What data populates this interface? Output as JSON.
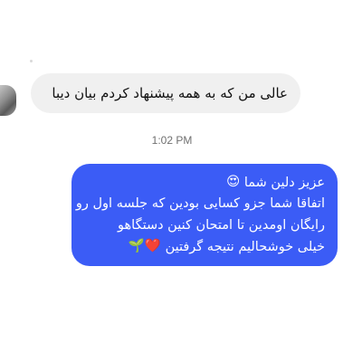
{
  "conversation": {
    "incoming_message": {
      "text": "عالی من که به همه پیشنهاد کردم بیان دیبا"
    },
    "timestamp": "1:02 PM",
    "outgoing_message": {
      "line_1_text": "عزیز دلین شما",
      "line_1_emoji": "😍",
      "line_2": "اتفاقا شما جزو کسایی بودین که جلسه اول رو",
      "line_3": "رایگان اومدین تا  امتحان کنین دستگاهو",
      "line_4_text": "خیلی خوشحالیم نتیجه گرفتین",
      "line_4_emoji": "❤️🌱"
    }
  },
  "colors": {
    "background": "#ffffff",
    "incoming_bubble": "#f0f0f0",
    "outgoing_bubble": "#3b5cf6",
    "timestamp_text": "#6f6f6f"
  }
}
